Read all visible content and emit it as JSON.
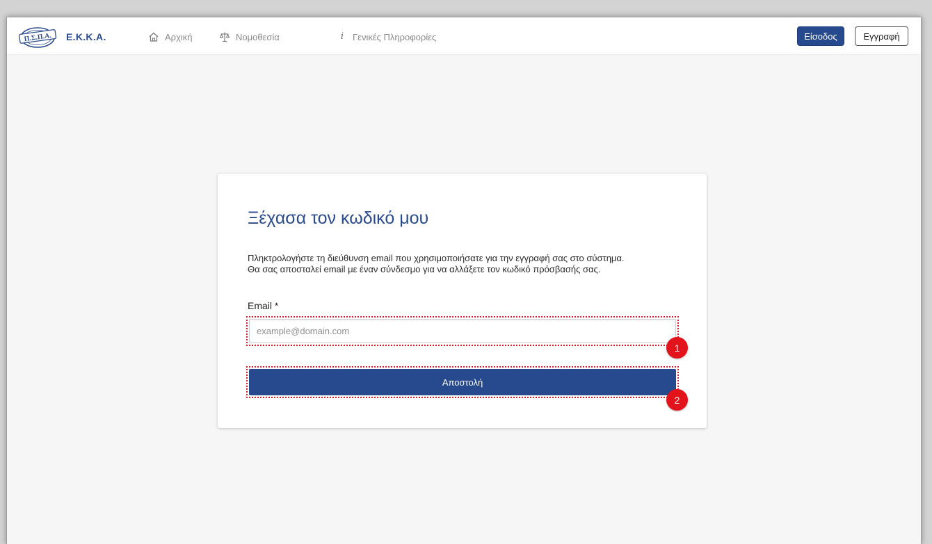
{
  "header": {
    "logo_text": "Π.Σ.Π.Α.",
    "brand": "Ε.Κ.Κ.Α.",
    "nav": [
      {
        "label": "Αρχική",
        "icon": "home-icon"
      },
      {
        "label": "Νομοθεσία",
        "icon": "scales-icon"
      },
      {
        "label": "Γενικές Πληροφορίες",
        "icon": "info-icon",
        "glyph": "i"
      }
    ],
    "login_label": "Είσοδος",
    "register_label": "Εγγραφή",
    "accent_color": "#274a8e"
  },
  "card": {
    "title": "Ξέχασα τον κωδικό μου",
    "description_lines": [
      "Πληκτρολογήστε τη διεύθυνση email που χρησιμοποιήσατε για την εγγραφή σας στο σύστημα.",
      "Θα σας αποσταλεί email με έναν σύνδεσμο για να αλλάξετε τον κωδικό πρόσβασής σας."
    ],
    "email_label": "Email *",
    "email_value": "",
    "email_placeholder": "example@domain.com",
    "submit_label": "Αποστολή"
  },
  "callouts": [
    "1",
    "2"
  ],
  "callout_color": "#e3131b"
}
